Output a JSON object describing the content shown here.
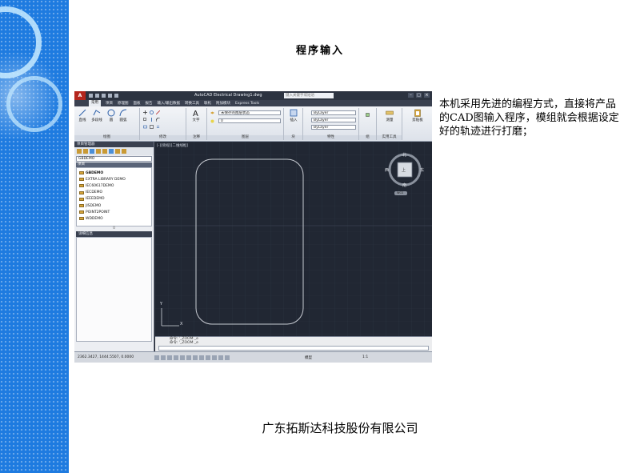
{
  "slide": {
    "title": "程序输入",
    "description": "本机采用先进的编程方式，直接将产品的CAD图输入程序，模组就会根据设定好的轨迹进行打磨；",
    "footer": "广东拓斯达科技股份有限公司"
  },
  "colors": {
    "side_strip": "#1e7be0",
    "cad_background": "#212733",
    "outline_stroke": "#c8ccd3"
  },
  "cad": {
    "app_button": "A",
    "window_title": "AutoCAD Electrical    Drawing1.dwg",
    "search_placeholder": "键入关键字或短语",
    "window_controls": [
      "–",
      "□",
      "×"
    ],
    "tabs": [
      "常用",
      "项目",
      "原理图",
      "面板",
      "报告",
      "输入/输出数据",
      "转换工具",
      "联机",
      "附加模块",
      "Express Tools"
    ],
    "ribbon": {
      "draw_tools": [
        "直线",
        "多段线",
        "圆",
        "圆弧"
      ],
      "text_tool": "文字",
      "insert_tool": "插入",
      "measure_tool": "测量",
      "paste_tool": "剪贴板",
      "layer_state": "未保存的图层状态",
      "layer_value": "0",
      "bylayer_1": "ByLayer",
      "bylayer_2": "ByLayer",
      "bylayer_3": "ByLayer",
      "panel_names": [
        "绘图",
        "修改",
        "注释",
        "图层",
        "块",
        "特性",
        "组",
        "实用工具"
      ]
    },
    "palette": {
      "title": "项目管理器",
      "selected_project": "GBDEMO",
      "section_label": "项目",
      "projects": [
        "GBDEMO",
        "EXTRA LIBRARY DEMO",
        "IEC60617DEMO",
        "IECDEMO",
        "IEEEDEMO",
        "JISDEMO",
        "POINT2POINT",
        "WDDEMO"
      ],
      "separator": "0",
      "details_label": "详细信息"
    },
    "drawing": {
      "viewport_label": "[-][俯视][二维线框]",
      "viewcube_top": "上",
      "viewcube_n": "北",
      "viewcube_s": "南",
      "viewcube_e": "东",
      "viewcube_w": "西",
      "wcs_label": "WCS",
      "axis_x": "X",
      "axis_y": "Y"
    },
    "command": {
      "line1": "命令: '_ZOOM _e",
      "line2": "命令: '_ZOOM _e"
    },
    "status": {
      "coordinates": "2362.3427,  1444.5507,  0.0000",
      "model_label": "模型",
      "zoom_label": "1:1"
    }
  }
}
